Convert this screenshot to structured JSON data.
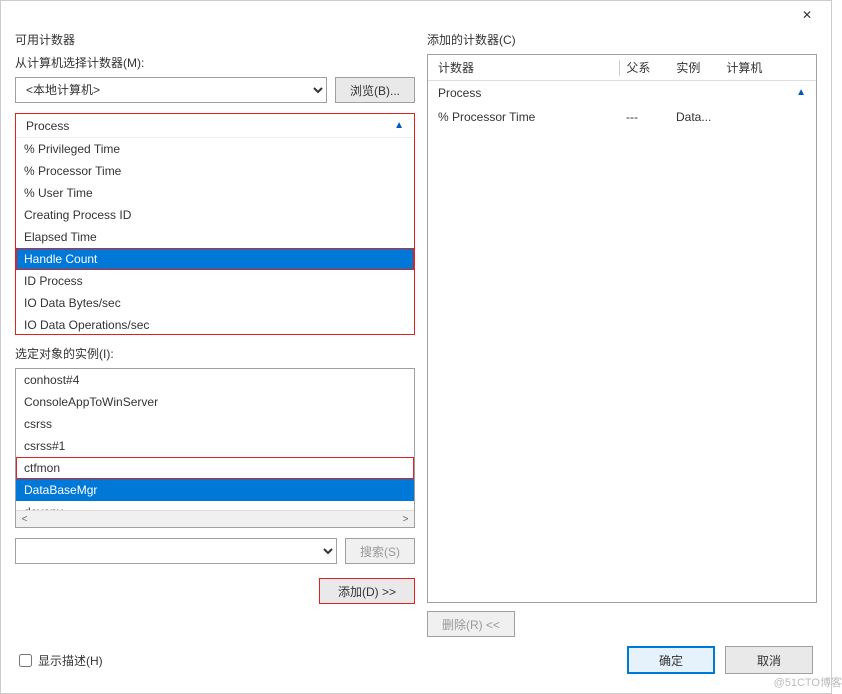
{
  "titlebar": {
    "close": "✕"
  },
  "left": {
    "available_label": "可用计数器",
    "from_computer_label": "从计算机选择计数器(M):",
    "computer_value": "<本地计算机>",
    "browse_btn": "浏览(B)...",
    "counter_group": "Process",
    "counters": [
      "% Privileged Time",
      "% Processor Time",
      "% User Time",
      "Creating Process ID",
      "Elapsed Time",
      "Handle Count",
      "ID Process",
      "IO Data Bytes/sec",
      "IO Data Operations/sec"
    ],
    "counter_selected_index": 5,
    "instances_label": "选定对象的实例(I):",
    "instances": [
      "conhost#4",
      "ConsoleAppToWinServer",
      "csrss",
      "csrss#1",
      "ctfmon",
      "DataBaseMgr",
      "devenv"
    ],
    "instance_selected_index": 5,
    "search_btn": "搜索(S)",
    "add_btn": "添加(D) >>"
  },
  "right": {
    "added_label": "添加的计数器(C)",
    "columns": {
      "counter": "计数器",
      "parent": "父系",
      "instance": "实例",
      "computer": "计算机"
    },
    "group": "Process",
    "rows": [
      {
        "counter": "% Processor Time",
        "parent": "---",
        "instance": "Data...",
        "computer": ""
      }
    ],
    "remove_btn": "删除(R) <<"
  },
  "footer": {
    "show_desc": "显示描述(H)",
    "ok": "确定",
    "cancel": "取消"
  },
  "watermark": "@51CTO博客"
}
